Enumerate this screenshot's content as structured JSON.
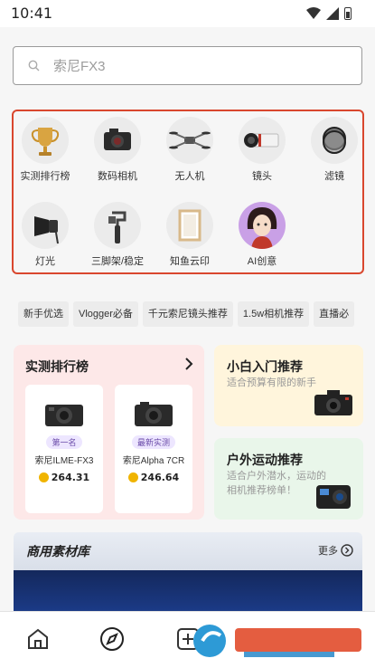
{
  "status_bar": {
    "time": "10:41"
  },
  "search": {
    "placeholder": "索尼FX3"
  },
  "categories": [
    {
      "label": "实测排行榜",
      "icon": "trophy-icon"
    },
    {
      "label": "数码相机",
      "icon": "camera-icon"
    },
    {
      "label": "无人机",
      "icon": "drone-icon"
    },
    {
      "label": "镜头",
      "icon": "lens-icon"
    },
    {
      "label": "滤镜",
      "icon": "filter-icon"
    },
    {
      "label": "灯光",
      "icon": "light-icon"
    },
    {
      "label": "三脚架/稳定",
      "icon": "gimbal-icon"
    },
    {
      "label": "知鱼云印",
      "icon": "frame-icon"
    },
    {
      "label": "AI创意",
      "icon": "ai-avatar-icon"
    }
  ],
  "tags": [
    "新手优选",
    "Vlogger必备",
    "千元索尼镜头推荐",
    "1.5w相机推荐",
    "直播必"
  ],
  "ranking": {
    "title": "实测排行榜",
    "items": [
      {
        "badge": "第一名",
        "name": "索尼ILME-FX3",
        "score": "264.31"
      },
      {
        "badge": "最新实测",
        "name": "索尼Alpha 7CR",
        "score": "246.64"
      }
    ]
  },
  "recommendations": {
    "beginner": {
      "title": "小白入门推荐",
      "subtitle": "适合预算有限的新手"
    },
    "outdoor": {
      "title": "户外运动推荐",
      "subtitle": "适合户外潜水，运动的相机推荐榜单！"
    }
  },
  "materials": {
    "title": "商用素材库",
    "more": "更多"
  },
  "colors": {
    "highlight_border": "#d9472e",
    "rank_bg": "#fde8e8",
    "beginner_bg": "#fff5dc",
    "outdoor_bg": "#e9f6ea",
    "medal": "#f0b400"
  }
}
